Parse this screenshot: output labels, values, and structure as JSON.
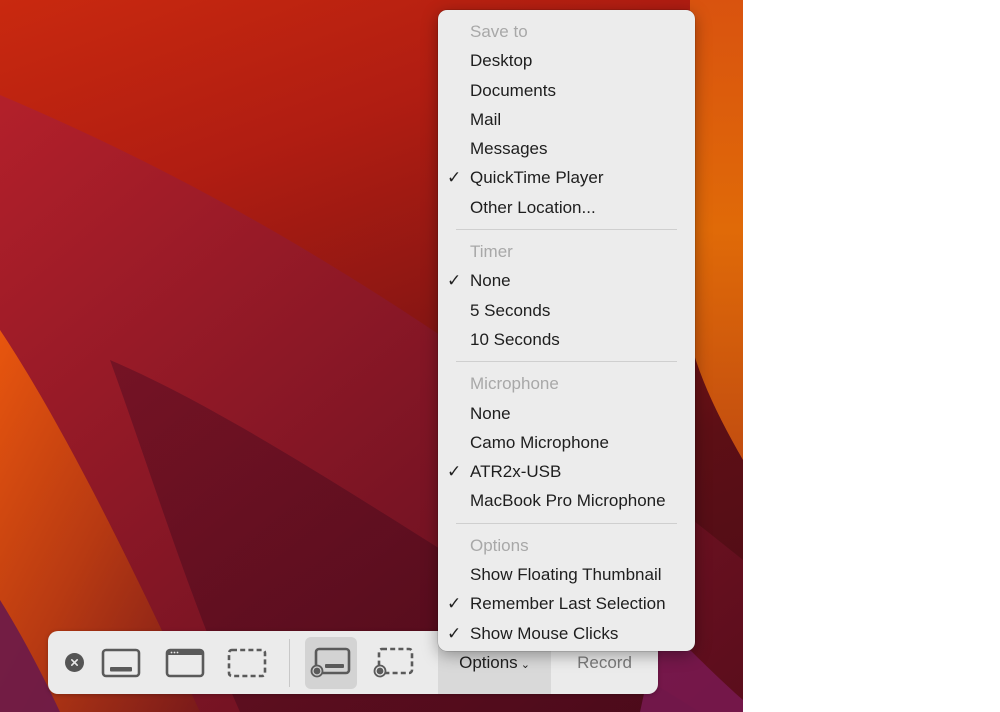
{
  "toolbar": {
    "buttons": [
      {
        "id": "close",
        "icon": "close-icon"
      },
      {
        "id": "capture-entire-screen",
        "icon": "entire-screen-icon",
        "selected": false
      },
      {
        "id": "capture-window",
        "icon": "window-icon",
        "selected": false
      },
      {
        "id": "capture-selection",
        "icon": "selection-icon",
        "selected": false
      },
      {
        "id": "record-entire-screen",
        "icon": "record-screen-icon",
        "selected": true
      },
      {
        "id": "record-selection",
        "icon": "record-selection-icon",
        "selected": false
      }
    ],
    "options_label": "Options",
    "options_chevron": "⌄",
    "record_label": "Record"
  },
  "menu": {
    "sections": [
      {
        "header": "Save to",
        "items": [
          {
            "label": "Desktop",
            "checked": false
          },
          {
            "label": "Documents",
            "checked": false
          },
          {
            "label": "Mail",
            "checked": false
          },
          {
            "label": "Messages",
            "checked": false
          },
          {
            "label": "QuickTime Player",
            "checked": true
          },
          {
            "label": "Other Location...",
            "checked": false
          }
        ]
      },
      {
        "header": "Timer",
        "items": [
          {
            "label": "None",
            "checked": true
          },
          {
            "label": "5 Seconds",
            "checked": false
          },
          {
            "label": "10 Seconds",
            "checked": false
          }
        ]
      },
      {
        "header": "Microphone",
        "items": [
          {
            "label": "None",
            "checked": false
          },
          {
            "label": "Camo Microphone",
            "checked": false
          },
          {
            "label": "ATR2x-USB",
            "checked": true
          },
          {
            "label": "MacBook Pro Microphone",
            "checked": false
          }
        ]
      },
      {
        "header": "Options",
        "items": [
          {
            "label": "Show Floating Thumbnail",
            "checked": false
          },
          {
            "label": "Remember Last Selection",
            "checked": true
          },
          {
            "label": "Show Mouse Clicks",
            "checked": true
          }
        ]
      }
    ],
    "check_glyph": "✓"
  },
  "colors": {
    "toolbar_bg": "#ebebeb",
    "menu_bg": "#ececec",
    "header_text": "#a8a8a8",
    "icon_gray": "#5a5a5a"
  }
}
